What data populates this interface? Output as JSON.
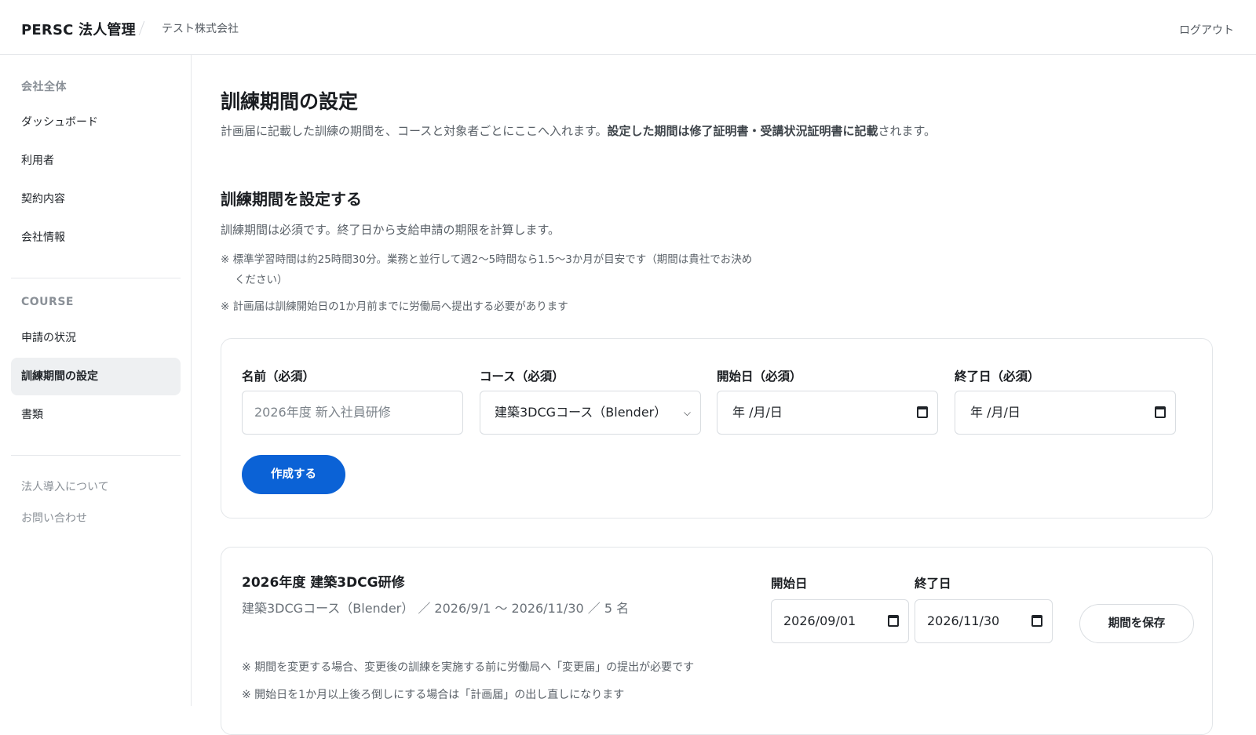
{
  "header": {
    "brand": "PERSC 法人管理",
    "company": "テスト株式会社",
    "logout": "ログアウト"
  },
  "sidebar": {
    "section1": "会社全体",
    "items1": [
      "ダッシュボード",
      "利用者",
      "契約内容",
      "会社情報"
    ],
    "section2": "COURSE",
    "items2": [
      "申請の状況",
      "訓練期間の設定",
      "書類"
    ],
    "active_item": "訓練期間の設定",
    "links": [
      "法人導入について",
      "お問い合わせ"
    ]
  },
  "page": {
    "title": "訓練期間の設定",
    "desc_prefix": "計画届に記載した訓練の期間を、コースと対象者ごとにここへ入れます。",
    "desc_bold": "設定した期間は修了証明書・受講状況証明書に記載",
    "desc_suffix": "されます。"
  },
  "section": {
    "title": "訓練期間を設定する",
    "desc": "訓練期間は必須です。終了日から支給申請の期限を計算します。",
    "note1_line1": "※ 標準学習時間は約25時間30分。業務と並行して週2〜5時間なら1.5〜3か月が目安です（期間は貴社でお決め",
    "note1_line2": "ください）",
    "note2": "※ 計画届は訓練開始日の1か月前までに労働局へ提出する必要があります"
  },
  "form": {
    "name_label": "名前（必須）",
    "name_placeholder": "2026年度 新入社員研修",
    "course_label": "コース（必須）",
    "course_value": "建築3DCGコース（Blender）",
    "start_label": "開始日（必須）",
    "start_placeholder": "年 /月/日",
    "end_label": "終了日（必須）",
    "end_placeholder": "年 /月/日",
    "create_button": "作成する"
  },
  "period_card": {
    "title": "2026年度 建築3DCG研修",
    "meta": "建築3DCGコース（Blender） ／ 2026/9/1 〜 2026/11/30 ／ 5 名",
    "start_label": "開始日",
    "start_value": "2026/09/01",
    "end_label": "終了日",
    "end_value": "2026/11/30",
    "save_button": "期間を保存",
    "note1": "※ 期間を変更する場合、変更後の訓練を実施する前に労働局へ「変更届」の提出が必要です",
    "note2": "※ 開始日を1か月以上後ろ倒しにする場合は「計画届」の出し直しになります"
  },
  "colors": {
    "primary": "#0b62d6",
    "active_bg": "#eef0f2",
    "border": "#e3e6e9"
  }
}
